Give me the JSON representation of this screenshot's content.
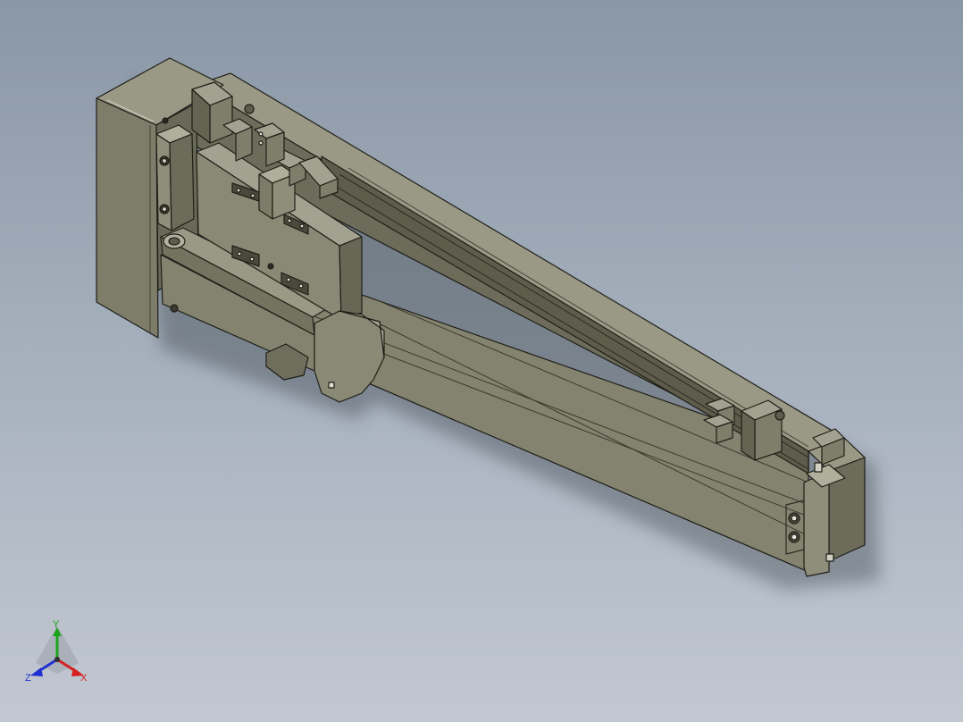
{
  "viewport": {
    "background_top": "#8a97a6",
    "background_bottom": "#c2c8d2"
  },
  "model": {
    "body_color": "#7d7c68",
    "face_light": "#9a9985",
    "face_dark": "#5e5d4c",
    "edge_color": "#1e1e18"
  },
  "triad": {
    "x_label": "X",
    "y_label": "Y",
    "z_label": "Z",
    "x_color": "#d42020",
    "y_color": "#1aa31a",
    "z_color": "#2030d0"
  }
}
